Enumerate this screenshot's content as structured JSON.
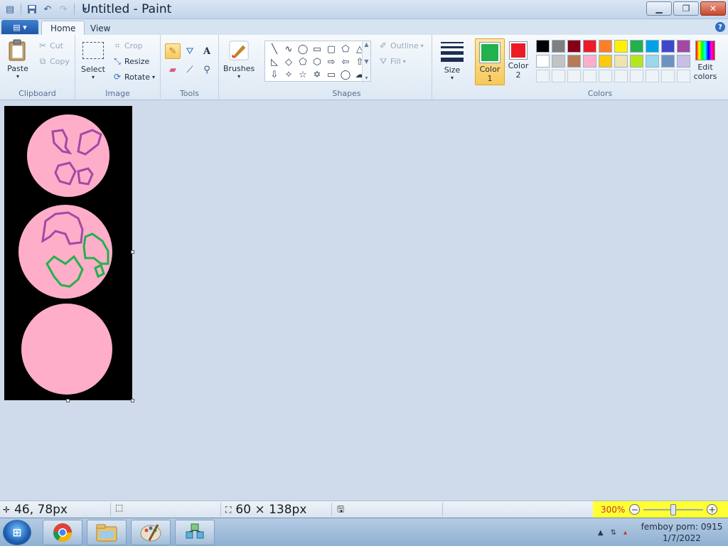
{
  "window": {
    "title": "Untitled - Paint",
    "minimize_glyph": "▁",
    "restore_glyph": "❐",
    "close_glyph": "✕"
  },
  "quick_access": {
    "items": [
      "save-icon",
      "undo-icon",
      "redo-icon",
      "customize-icon"
    ]
  },
  "tabs": {
    "app_menu_glyph": "▤ ▾",
    "home": "Home",
    "view": "View",
    "help_glyph": "?"
  },
  "ribbon": {
    "clipboard": {
      "label": "Clipboard",
      "paste": "Paste",
      "cut": "Cut",
      "copy": "Copy"
    },
    "image": {
      "label": "Image",
      "select": "Select",
      "crop": "Crop",
      "resize": "Resize",
      "rotate": "Rotate"
    },
    "tools": {
      "label": "Tools",
      "items": [
        "pencil-icon",
        "fill-icon",
        "text-icon",
        "eraser-icon",
        "color-picker-icon",
        "magnifier-icon"
      ],
      "active": "pencil-icon"
    },
    "brushes": {
      "label": "Brushes"
    },
    "shapes": {
      "label": "Shapes",
      "outline": "Outline",
      "fill": "Fill",
      "glyphs": [
        "╲",
        "∿",
        "◯",
        "▭",
        "▢",
        "⬠",
        "△",
        "◺",
        "◇",
        "⬠",
        "⬡",
        "⇨",
        "⇦",
        "⇧",
        "⇩",
        "✧",
        "☆",
        "✡",
        "▭",
        "◯",
        "☁"
      ]
    },
    "size": {
      "label": "Size"
    },
    "colors": {
      "label": "Colors",
      "color1_label": "Color 1",
      "color2_label": "Color 2",
      "color1": "#22b14c",
      "color2": "#ed1c24",
      "edit_colors": "Edit colors",
      "palette": [
        "#000000",
        "#7f7f7f",
        "#880015",
        "#ed1c24",
        "#ff7f27",
        "#fff200",
        "#22b14c",
        "#00a2e8",
        "#3f48cc",
        "#a349a4",
        "#ffffff",
        "#c3c3c3",
        "#b97a57",
        "#ffaec9",
        "#ffc90e",
        "#efe4b0",
        "#b5e61d",
        "#99d9ea",
        "#7092be",
        "#c8bfe7"
      ]
    }
  },
  "canvas": {
    "background": "#000000",
    "circle_fill": "#ffaec9",
    "stroke_purple": "#a349a4",
    "stroke_green": "#22b14c"
  },
  "status": {
    "cursor_position": "46, 78px",
    "selection_size": "",
    "image_size": "60 × 138px",
    "zoom": "300%",
    "zoom_level": 0.5
  },
  "taskbar": {
    "start_glyph": "⊞",
    "apps": [
      "chrome-icon",
      "file-explorer-icon",
      "paint-icon",
      "network-icon"
    ],
    "clock_line1": "femboy porn: 0915",
    "clock_line2": "1/7/2022"
  }
}
